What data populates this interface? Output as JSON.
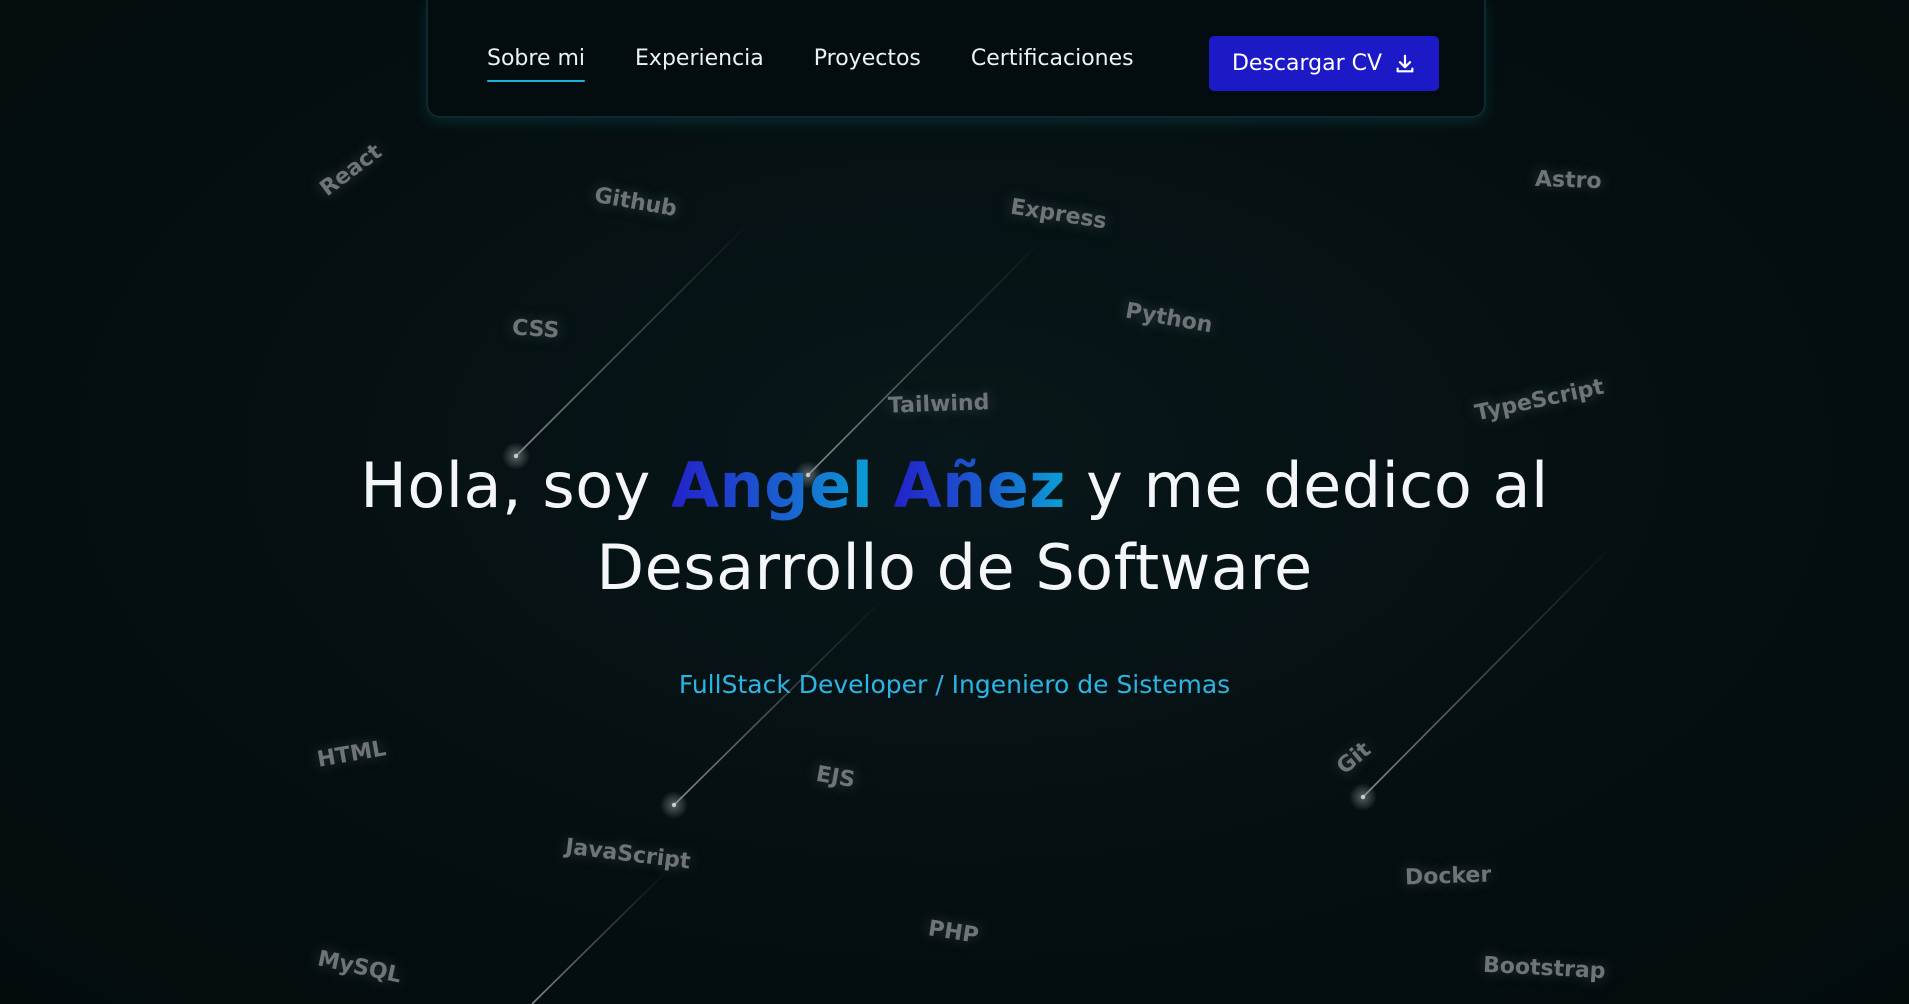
{
  "nav": {
    "links": [
      {
        "label": "Sobre mi",
        "active": true
      },
      {
        "label": "Experiencia",
        "active": false
      },
      {
        "label": "Proyectos",
        "active": false
      },
      {
        "label": "Certificaciones",
        "active": false
      }
    ],
    "cv_button": {
      "label": "Descargar CV",
      "icon": "download-icon"
    }
  },
  "hero": {
    "intro": "Hola, soy",
    "name_first": "Angel",
    "name_last": "Añez",
    "rest_line1": "y me dedico al",
    "line2": "Desarrollo de Software",
    "subtitle": "FullStack Developer / Ingeniero de Sistemas"
  },
  "tags": {
    "react": "React",
    "github": "Github",
    "express": "Express",
    "astro": "Astro",
    "css": "CSS",
    "python": "Python",
    "tailwind": "Tailwind",
    "typescript": "TypeScript",
    "html": "HTML",
    "ejs": "EJS",
    "git": "Git",
    "javascript": "JavaScript",
    "docker": "Docker",
    "php": "PHP",
    "mysql": "MySQL",
    "bootstrap": "Bootstrap"
  },
  "colors": {
    "background": "#040e10",
    "accent_button": "#1c19c7",
    "accent_cyan": "#2bb5e4",
    "nav_underline": "#20b3d8"
  }
}
